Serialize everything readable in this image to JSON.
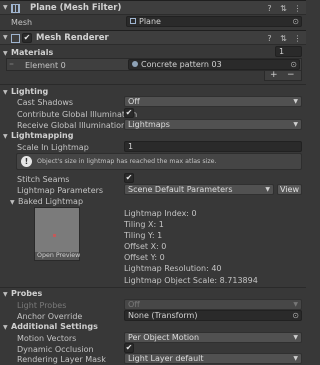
{
  "mesh_filter": {
    "title": "Plane (Mesh Filter)",
    "mesh_label": "Mesh",
    "mesh_value": "Plane"
  },
  "mesh_renderer": {
    "title": "Mesh Renderer",
    "enabled": true,
    "materials": {
      "header": "Materials",
      "count": "1",
      "element_label": "Element 0",
      "element_value": "Concrete pattern 03"
    },
    "lighting": {
      "header": "Lighting",
      "cast_shadows_label": "Cast Shadows",
      "cast_shadows_value": "Off",
      "contribute_gi_label": "Contribute Global Illumination",
      "contribute_gi_checked": true,
      "receive_gi_label": "Receive Global Illumination",
      "receive_gi_value": "Lightmaps"
    },
    "lightmapping": {
      "header": "Lightmapping",
      "scale_label": "Scale In Lightmap",
      "scale_value": "1",
      "warning_text": "Object's size in lightmap has reached the max atlas size.",
      "stitch_seams_label": "Stitch Seams",
      "stitch_seams_checked": true,
      "params_label": "Lightmap Parameters",
      "params_value": "Scene Default Parameters",
      "view_button": "View",
      "baked_header": "Baked Lightmap",
      "open_preview": "Open Preview",
      "info": [
        "Lightmap Index: 0",
        "Tiling X: 1",
        "Tiling Y: 1",
        "Offset X: 0",
        "Offset Y: 0",
        "Lightmap Resolution: 40",
        "Lightmap Object Scale: 8.713894"
      ]
    },
    "probes": {
      "header": "Probes",
      "light_probes_label": "Light Probes",
      "light_probes_value": "Off",
      "anchor_label": "Anchor Override",
      "anchor_value": "None (Transform)"
    },
    "additional": {
      "header": "Additional Settings",
      "motion_label": "Motion Vectors",
      "motion_value": "Per Object Motion",
      "occlusion_label": "Dynamic Occlusion",
      "occlusion_checked": true,
      "layer_label": "Rendering Layer Mask",
      "layer_value": "Light Layer default"
    }
  }
}
